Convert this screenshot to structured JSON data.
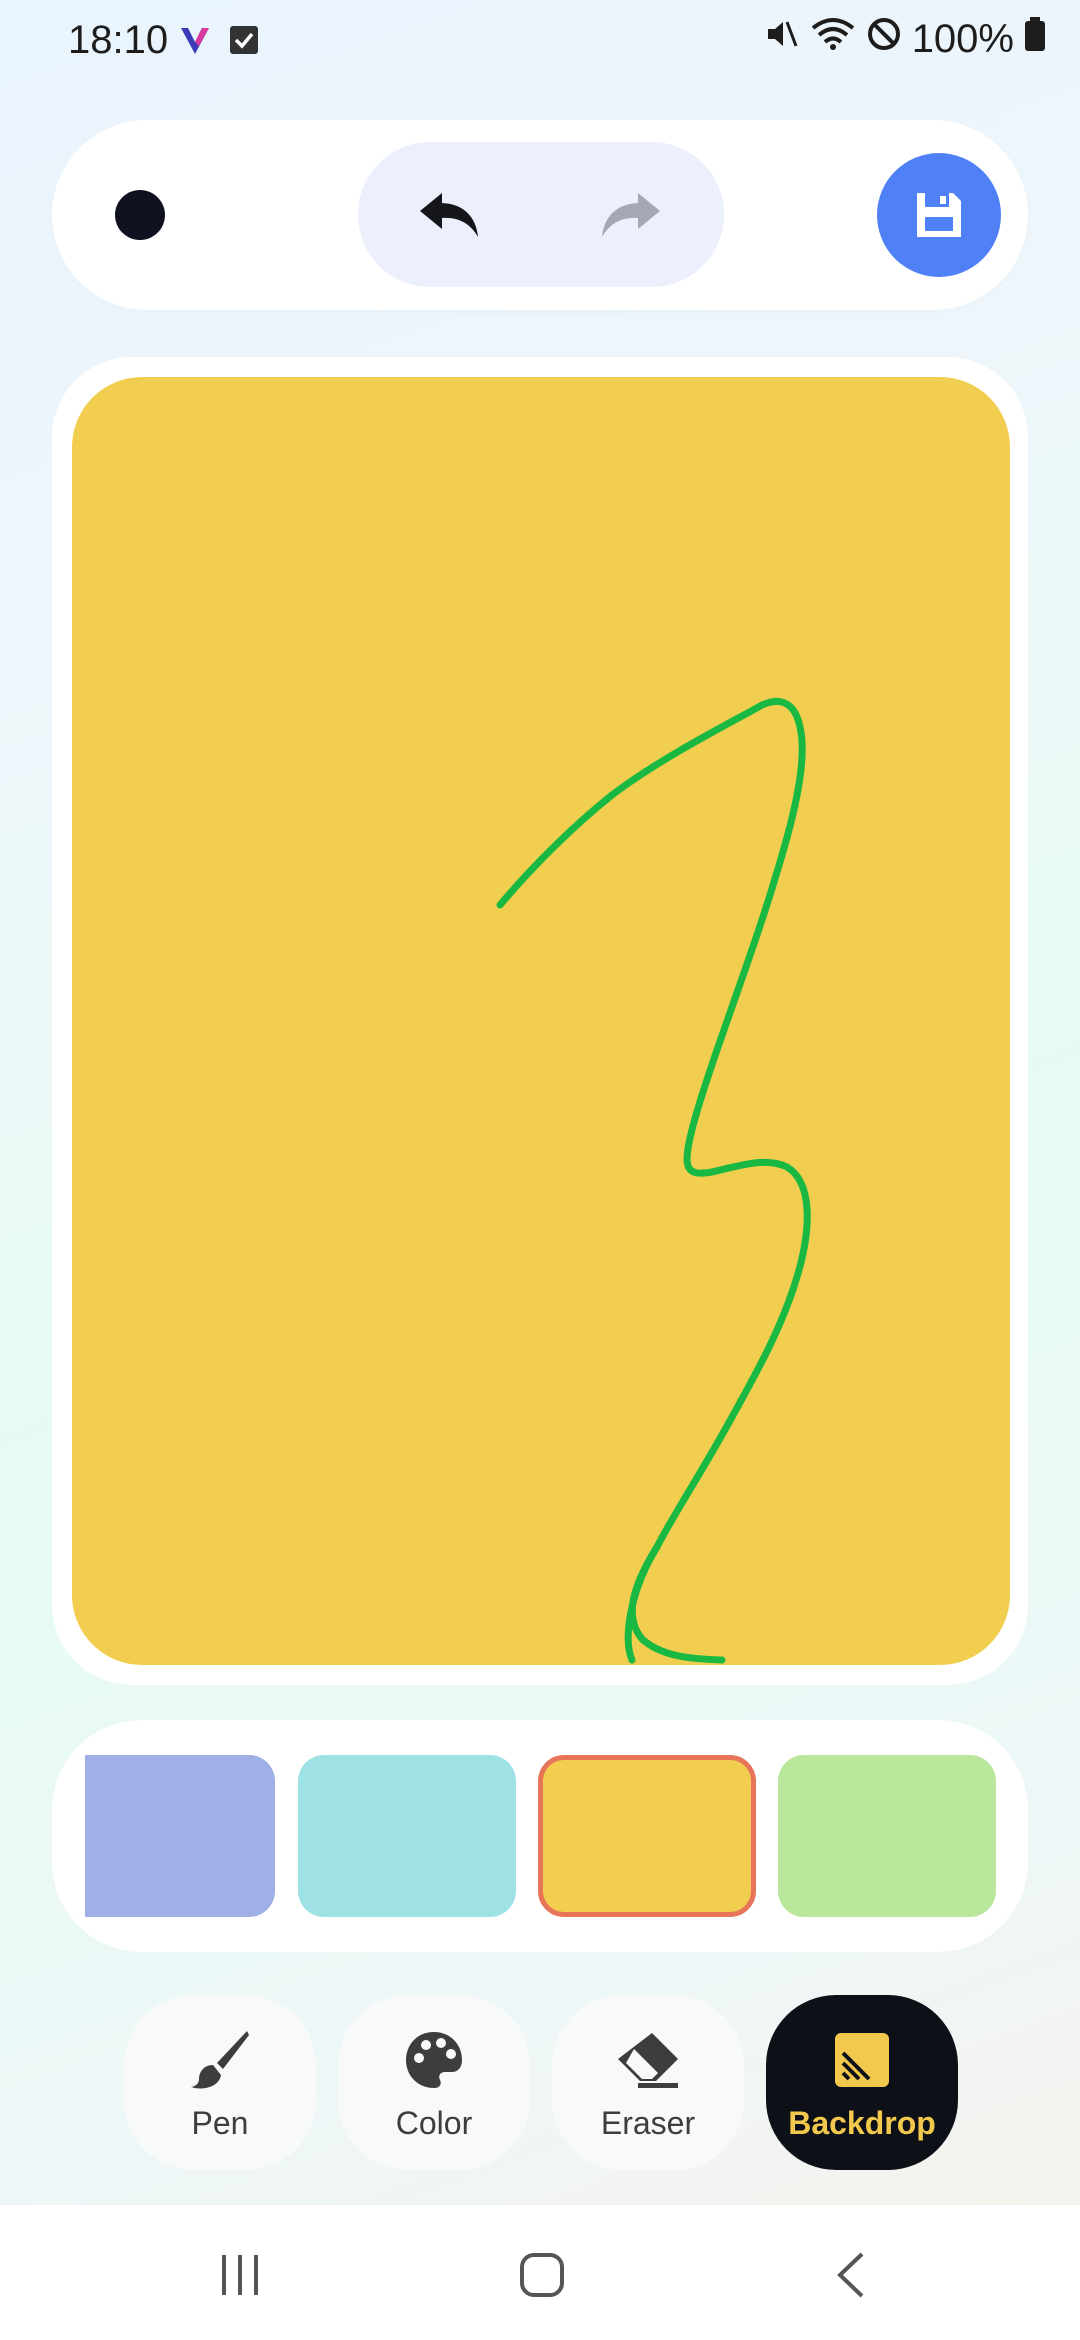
{
  "status_bar": {
    "time": "18:10",
    "battery": "100%",
    "icons": [
      "app-v-icon",
      "checkbox-icon",
      "mute-icon",
      "wifi-icon",
      "do-not-disturb-icon",
      "battery-icon"
    ]
  },
  "toolbar": {
    "pen_color": "#0f1020",
    "undo_icon": "undo-icon",
    "redo_icon": "redo-icon",
    "save_icon": "save-icon",
    "save_color": "#4f80f5"
  },
  "canvas": {
    "background": "#f1ce4f",
    "stroke_color": "#18b843"
  },
  "swatches": [
    {
      "color": "#9fb0e6",
      "selected": false
    },
    {
      "color": "#9fe2e6",
      "selected": false
    },
    {
      "color": "#f1ce4f",
      "selected": true
    },
    {
      "color": "#bae79c",
      "selected": false
    }
  ],
  "tools": {
    "pen": "Pen",
    "color": "Color",
    "eraser": "Eraser",
    "backdrop": "Backdrop"
  },
  "nav": {
    "icons": [
      "recent-apps-icon",
      "home-icon",
      "back-icon"
    ]
  }
}
